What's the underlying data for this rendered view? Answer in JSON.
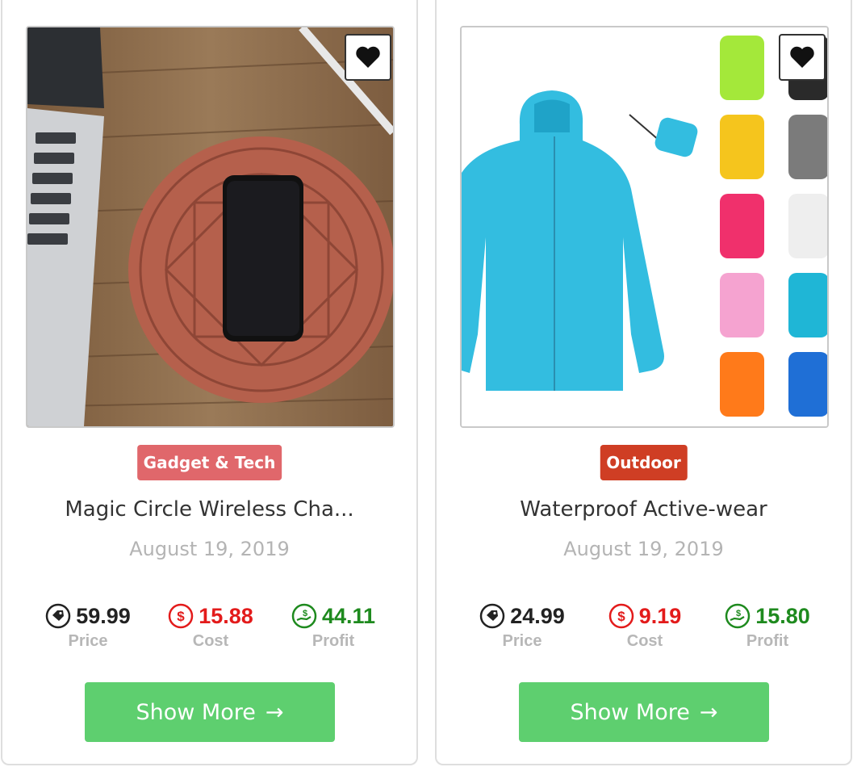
{
  "products": [
    {
      "category": "Gadget & Tech",
      "category_color": "#e0676b",
      "title": "Magic Circle Wireless Cha...",
      "date": "August 19, 2019",
      "price": "59.99",
      "cost": "15.88",
      "profit": "44.11",
      "labels": {
        "price": "Price",
        "cost": "Cost",
        "profit": "Profit"
      },
      "button": "Show More",
      "button_arrow": "→",
      "image_icon": "wireless-charger-image"
    },
    {
      "category": "Outdoor",
      "category_color": "#cf3e24",
      "title": "Waterproof Active-wear",
      "date": "August 19, 2019",
      "price": "24.99",
      "cost": "9.19",
      "profit": "15.80",
      "labels": {
        "price": "Price",
        "cost": "Cost",
        "profit": "Profit"
      },
      "button": "Show More",
      "button_arrow": "→",
      "image_icon": "jacket-image"
    }
  ],
  "colors": {
    "price": "#222222",
    "cost": "#e31b1b",
    "profit": "#1e8a1e",
    "button": "#5ecf6f"
  }
}
